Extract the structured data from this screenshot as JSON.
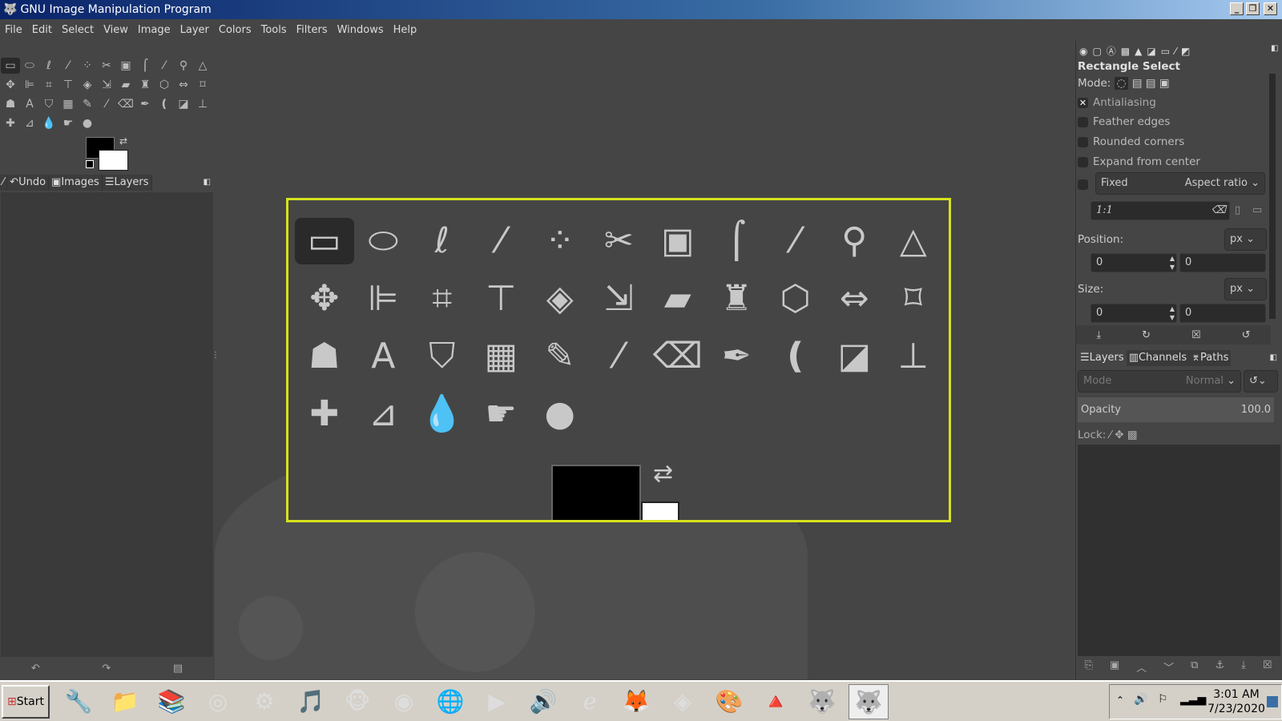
{
  "window": {
    "title": "GNU Image Manipulation Program"
  },
  "menu": [
    "File",
    "Edit",
    "Select",
    "View",
    "Image",
    "Layer",
    "Colors",
    "Tools",
    "Filters",
    "Windows",
    "Help"
  ],
  "tools": [
    {
      "name": "rect-select",
      "glyph": "▭"
    },
    {
      "name": "ellipse-select",
      "glyph": "⬭"
    },
    {
      "name": "free-select",
      "glyph": "ℓ"
    },
    {
      "name": "fuzzy-select",
      "glyph": "⁄"
    },
    {
      "name": "color-select",
      "glyph": "⁘"
    },
    {
      "name": "scissors",
      "glyph": "✂"
    },
    {
      "name": "foreground-select",
      "glyph": "▣"
    },
    {
      "name": "paths",
      "glyph": "⌠"
    },
    {
      "name": "color-picker",
      "glyph": "⁄"
    },
    {
      "name": "zoom",
      "glyph": "⚲"
    },
    {
      "name": "measure",
      "glyph": "△"
    },
    {
      "name": "move",
      "glyph": "✥"
    },
    {
      "name": "align",
      "glyph": "⊫"
    },
    {
      "name": "crop",
      "glyph": "⌗"
    },
    {
      "name": "unified-transform",
      "glyph": "⊤"
    },
    {
      "name": "rotate",
      "glyph": "◈"
    },
    {
      "name": "scale",
      "glyph": "⇲"
    },
    {
      "name": "shear",
      "glyph": "▰"
    },
    {
      "name": "warp",
      "glyph": "♜"
    },
    {
      "name": "perspective",
      "glyph": "⬡"
    },
    {
      "name": "flip",
      "glyph": "⇔"
    },
    {
      "name": "cage",
      "glyph": "⌑"
    },
    {
      "name": "smudge-wave",
      "glyph": "☗"
    },
    {
      "name": "text",
      "glyph": "A"
    },
    {
      "name": "bucket-fill",
      "glyph": "⛉"
    },
    {
      "name": "blend",
      "glyph": "▦"
    },
    {
      "name": "pencil",
      "glyph": "✎"
    },
    {
      "name": "paintbrush",
      "glyph": "⁄"
    },
    {
      "name": "eraser",
      "glyph": "⌫"
    },
    {
      "name": "airbrush",
      "glyph": "✒"
    },
    {
      "name": "ink",
      "glyph": "❪"
    },
    {
      "name": "mypaint",
      "glyph": "◪"
    },
    {
      "name": "clone",
      "glyph": "⊥"
    },
    {
      "name": "heal",
      "glyph": "✚"
    },
    {
      "name": "perspective-clone",
      "glyph": "⊿"
    },
    {
      "name": "blur",
      "glyph": "💧"
    },
    {
      "name": "smudge",
      "glyph": "☛"
    },
    {
      "name": "dodge-burn",
      "glyph": "●"
    }
  ],
  "left_dock": {
    "tabs": [
      "Undo",
      "Images",
      "Layers"
    ]
  },
  "tool_options": {
    "title": "Rectangle Select",
    "mode_label": "Mode:",
    "antialiasing": "Antialiasing",
    "feather": "Feather edges",
    "rounded": "Rounded corners",
    "expand": "Expand from center",
    "fixed": "Fixed",
    "fixed_option": "Aspect ratio",
    "ratio": "1:1",
    "position_label": "Position:",
    "position_unit": "px",
    "pos_x": "0",
    "pos_y": "0",
    "size_label": "Size:",
    "size_unit": "px",
    "size_w": "0",
    "size_h": "0"
  },
  "layers_dock": {
    "tabs": [
      "Layers",
      "Channels",
      "Paths"
    ],
    "mode_label": "Mode",
    "mode_value": "Normal",
    "opacity_label": "Opacity",
    "opacity_value": "100.0",
    "lock_label": "Lock:"
  },
  "taskbar": {
    "start": "Start",
    "time": "3:01 AM",
    "date": "7/23/2020",
    "apps": [
      {
        "name": "tool-app",
        "glyph": "🔧"
      },
      {
        "name": "file-explorer",
        "glyph": "📁"
      },
      {
        "name": "winrar",
        "glyph": "📚"
      },
      {
        "name": "screenshot-app",
        "glyph": "◎"
      },
      {
        "name": "settings",
        "glyph": "⚙"
      },
      {
        "name": "media-app",
        "glyph": "🎵"
      },
      {
        "name": "monkey-app",
        "glyph": "🐵"
      },
      {
        "name": "chrome",
        "glyph": "◉"
      },
      {
        "name": "ie-tab",
        "glyph": "🌐"
      },
      {
        "name": "video-player",
        "glyph": "▶"
      },
      {
        "name": "speaker-app",
        "glyph": "🔊"
      },
      {
        "name": "internet-explorer",
        "glyph": "ℯ"
      },
      {
        "name": "firefox",
        "glyph": "🦊"
      },
      {
        "name": "vs-app",
        "glyph": "◈"
      },
      {
        "name": "paint",
        "glyph": "🎨"
      },
      {
        "name": "vlc",
        "glyph": "🔺"
      },
      {
        "name": "gimp",
        "glyph": "🐺"
      },
      {
        "name": "gimp-active",
        "glyph": "🐺"
      }
    ]
  }
}
